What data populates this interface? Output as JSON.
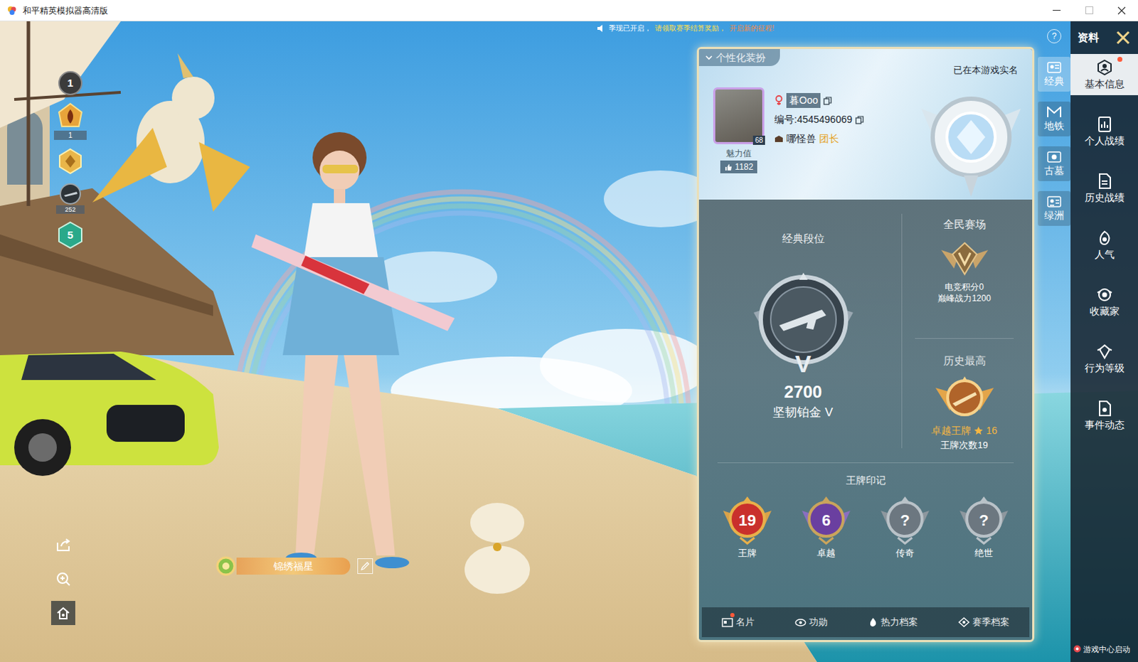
{
  "window": {
    "title": "和平精英模拟器高清版"
  },
  "notice": [
    {
      "text": "季现已开启，",
      "color": "#ffffff"
    },
    {
      "text": "请领取赛季结算奖励，",
      "color": "#ffe04a"
    },
    {
      "text": "开启新的征程!",
      "color": "#ff8a3a"
    }
  ],
  "help": "?",
  "scene": {
    "level_badge": "1",
    "flame_badge": "1",
    "gun_badge": "252",
    "hex_badge": "5",
    "nameplate": "锦绣福星"
  },
  "profile": {
    "outfit_tab": "个性化装扮",
    "verified": "已在本游戏实名",
    "name": "暮Ooo",
    "level": "68",
    "id": "编号:4545496069",
    "team": "哪怪兽",
    "team_role": "团长",
    "charm_label": "魅力值",
    "charm": "1182"
  },
  "ranks": {
    "classic": {
      "title": "经典段位",
      "emblem": "V",
      "score": "2700",
      "tier": "坚韧铂金 V"
    },
    "public": {
      "title": "全民赛场",
      "esports": "电竞积分0",
      "peak": "巅峰战力1200"
    },
    "best": {
      "title": "历史最高",
      "tier": "卓越王牌",
      "stars": "16",
      "ace_count": "王牌次数19"
    }
  },
  "seals": {
    "title": "王牌印记",
    "items": [
      {
        "label": "王牌",
        "value": "19",
        "kind": "ace"
      },
      {
        "label": "卓越",
        "value": "6",
        "kind": "excellent"
      },
      {
        "label": "传奇",
        "value": "?",
        "kind": "locked"
      },
      {
        "label": "绝世",
        "value": "?",
        "kind": "locked"
      }
    ]
  },
  "bottom_tabs": [
    {
      "label": "名片",
      "dot": true
    },
    {
      "label": "功勋",
      "dot": false
    },
    {
      "label": "热力档案",
      "dot": false
    },
    {
      "label": "赛季档案",
      "dot": false
    }
  ],
  "modes": [
    {
      "label": "经典",
      "selected": true
    },
    {
      "label": "地铁",
      "selected": false
    },
    {
      "label": "古墓",
      "selected": false
    },
    {
      "label": "绿洲",
      "selected": false
    }
  ],
  "nav": {
    "title": "资料",
    "items": [
      {
        "label": "基本信息",
        "selected": true,
        "dot": true
      },
      {
        "label": "个人战绩",
        "selected": false,
        "dot": false
      },
      {
        "label": "历史战绩",
        "selected": false,
        "dot": false
      },
      {
        "label": "人气",
        "selected": false,
        "dot": false
      },
      {
        "label": "收藏家",
        "selected": false,
        "dot": false
      },
      {
        "label": "行为等级",
        "selected": false,
        "dot": false
      },
      {
        "label": "事件动态",
        "selected": false,
        "dot": false
      }
    ]
  },
  "footer": "游戏中心启动"
}
